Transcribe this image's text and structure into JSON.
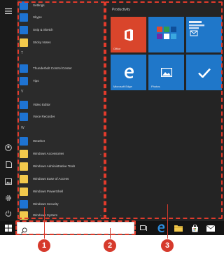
{
  "start_menu": {
    "app_list": {
      "rows": [
        {
          "label": "Settings",
          "color": "#1e73d2"
        },
        {
          "label": "Skype",
          "color": "#1e73d2"
        },
        {
          "label": "Snip & Sketch",
          "color": "#1e73d2"
        },
        {
          "label": "Sticky Notes",
          "color": "#f2c94c"
        },
        {
          "label": "Thunderbolt Control Center",
          "color": "#1e73d2"
        },
        {
          "label": "Tips",
          "color": "#1e73d2"
        },
        {
          "label": "Video Editor",
          "color": "#1e73d2"
        },
        {
          "label": "Voice Recorder",
          "color": "#1e73d2"
        },
        {
          "label": "Weather",
          "color": "#1e73d2"
        },
        {
          "label": "Windows Accessories",
          "color": "#f2c94c"
        },
        {
          "label": "Windows Administrative Tools",
          "color": "#f2c94c"
        },
        {
          "label": "Windows Ease of Access",
          "color": "#f2c94c"
        },
        {
          "label": "Windows PowerShell",
          "color": "#f2c94c"
        },
        {
          "label": "Windows Security",
          "color": "#1e73d2"
        },
        {
          "label": "Windows System",
          "color": "#f2c94c"
        }
      ],
      "group_letters": [
        "T",
        "V",
        "W"
      ]
    },
    "tiles": {
      "group_title": "Productivity",
      "items": [
        {
          "label": "Office",
          "color": "#d9452b",
          "icon": "office-icon"
        },
        {
          "label": "",
          "color": "#1f77c9",
          "icon": "app-grid-icon"
        },
        {
          "label": "",
          "color": "#1f77c9",
          "icon": "mail-icon"
        },
        {
          "label": "Microsoft Edge",
          "color": "#1f77c9",
          "icon": "edge-icon"
        },
        {
          "label": "Photos",
          "color": "#1f77c9",
          "icon": "photos-icon"
        },
        {
          "label": "",
          "color": "#1f77c9",
          "icon": "check-icon"
        }
      ]
    }
  },
  "callouts": [
    "1",
    "2",
    "3"
  ],
  "colors": {
    "accent": "#1f77c9",
    "highlight": "#e23b2c",
    "background": "#1f1f1f"
  }
}
